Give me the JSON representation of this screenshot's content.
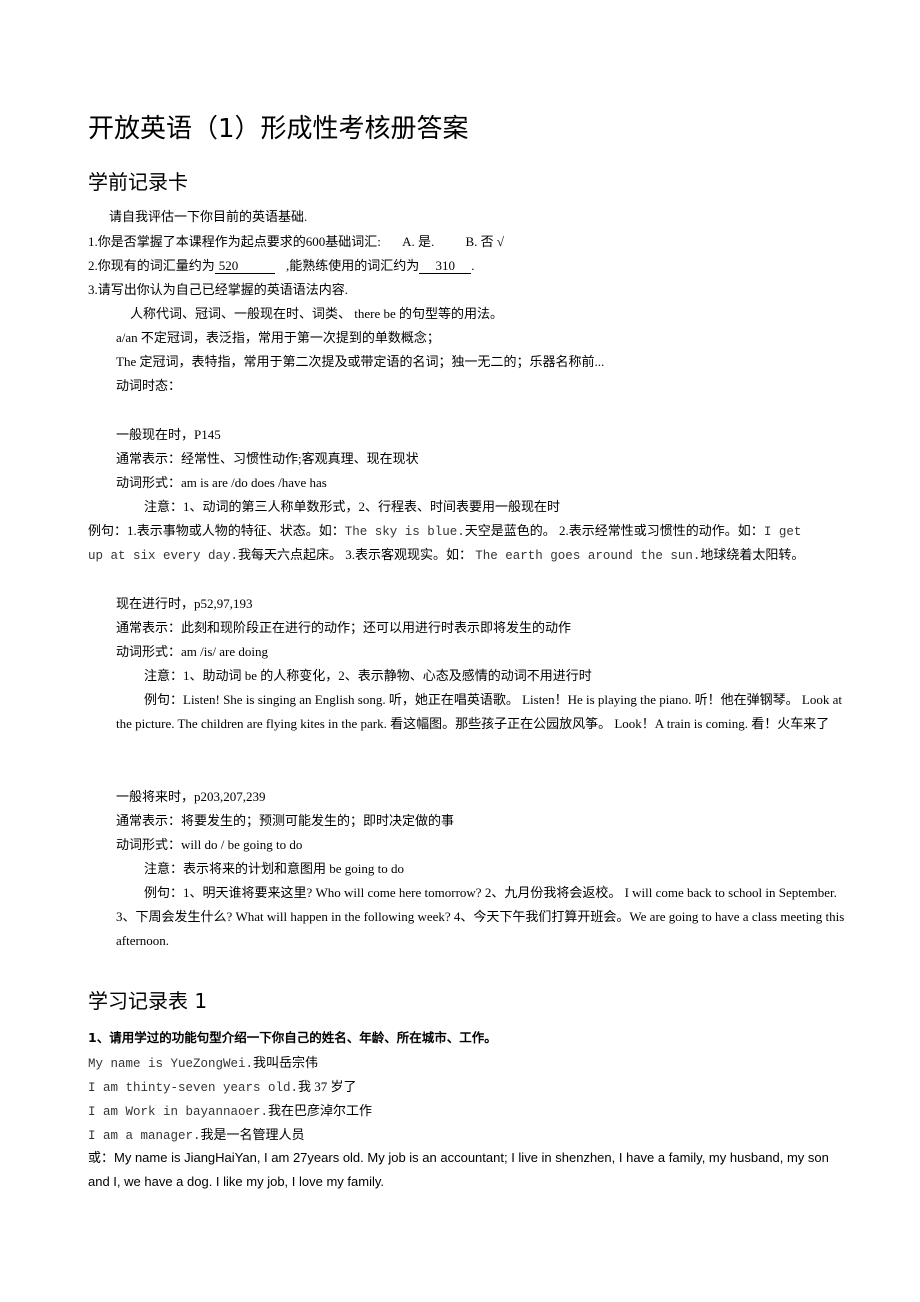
{
  "title": "开放英语（1）形成性考核册答案",
  "section1": {
    "heading": "学前记录卡",
    "intro": "请自我评估一下你目前的英语基础.",
    "q1": {
      "text": "1.你是否掌握了本课程作为起点要求的600基础词汇:",
      "option_a": "A.  是.",
      "option_b": "B.  否 √"
    },
    "q2": {
      "prefix": "2.你现有的词汇量约为",
      "value1": "520",
      "middle": " ,能熟练使用的词汇约为",
      "value2": "310",
      "suffix": "."
    },
    "q3": "3.请写出你认为自己已经掌握的英语语法内容.",
    "answer_line": "人称代词、冠词、一般现在时、词类、  there be 的句型等的用法。",
    "article_a": "a/an 不定冠词，表泛指，常用于第一次提到的单数概念；",
    "article_the": "The  定冠词，表特指，常用于第二次提及或带定语的名词；独一无二的；乐器名称前...",
    "tenses_label": "动词时态：",
    "present_simple": {
      "heading": "一般现在时，P145",
      "usage": "通常表示：经常性、习惯性动作;客观真理、现在现状",
      "forms": "动词形式：am is are    /do does /have    has",
      "note": "注意：1、动词的第三人称单数形式，2、行程表、时间表要用一般现在时",
      "examples_line1_a": "例句：1.表示事物或人物的特征、状态。如：",
      "examples_line1_b": "The sky is blue.",
      "examples_line1_c": "天空是蓝色的。     2.表示经常性或习惯性的动作。如：",
      "examples_line1_d": "I get",
      "examples_line2_a": "up at six every day.",
      "examples_line2_b": "我每天六点起床。     3.表示客观现实。如：   ",
      "examples_line2_c": "The earth goes around the sun.",
      "examples_line2_d": "地球绕着太阳转。"
    },
    "present_continuous": {
      "heading": "现在进行时，p52,97,193",
      "usage": "通常表示：此刻和现阶段正在进行的动作；还可以用进行时表示即将发生的动作",
      "forms": "动词形式：am /is/ are doing",
      "note": "注意：1、助动词 be 的人称变化，2、表示静物、心态及感情的动词不用进行时",
      "examples": "例句：Listen! She is singing an English song.  听，她正在唱英语歌。      Listen！He is playing the piano.  听！他在弹钢琴。    Look at the picture. The children are flying kites in the park.  看这幅图。那些孩子正在公园放风筝。    Look！A train is coming.  看！火车来了"
    },
    "future_simple": {
      "heading": "一般将来时，p203,207,239",
      "usage": "通常表示：将要发生的；预测可能发生的；即时决定做的事",
      "forms": "动词形式：will do    /     be    going    to    do",
      "note": "注意：表示将来的计划和意图用 be    going    to    do",
      "examples": "例句：1、明天谁将要来这里? Who will come here tomorrow?        2、九月份我将会返校。  I will come back to school in September.      3、下周会发生什么? What will happen in the following week?        4、今天下午我们打算开班会。We are going to have a class meeting this afternoon."
    }
  },
  "section2": {
    "heading": "学习记录表 1",
    "question": "1、请用学过的功能句型介绍一下你自己的姓名、年龄、所在城市、工作。",
    "answers": [
      {
        "en": "My name is YueZongWei.",
        "zh": "我叫岳宗伟"
      },
      {
        "en": "I am thinty-seven years old.",
        "zh": "我 37 岁了"
      },
      {
        "en": "I am Work in bayannaoer.",
        "zh": "我在巴彦淖尔工作"
      },
      {
        "en": "I am a manager.",
        "zh": "我是一名管理人员"
      }
    ],
    "alt_prefix": "或：",
    "alt_answer": "My name is JiangHaiYan, I am 27years old. My job is an accountant; I live in shenzhen, I have a family, my husband, my son and I, we have a dog. I like my job, I love my family."
  }
}
